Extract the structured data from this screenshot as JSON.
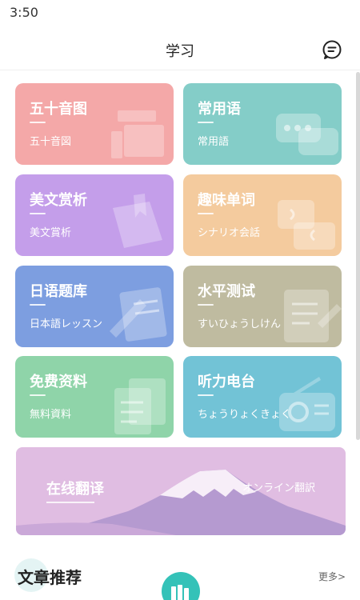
{
  "status_bar": {
    "time": "3:50"
  },
  "header": {
    "title": "学习",
    "message_icon": "chat-bubble-icon"
  },
  "cards": [
    {
      "title": "五十音图",
      "subtitle": "五十音図",
      "color": "#f4a8a8",
      "icon": "book-stack-icon"
    },
    {
      "title": "常用语",
      "subtitle": "常用語",
      "color": "#84cdc8",
      "icon": "chat-bubbles-icon"
    },
    {
      "title": "美文赏析",
      "subtitle": "美文賞析",
      "color": "#c49eea",
      "icon": "bookmark-book-icon"
    },
    {
      "title": "趣味单词",
      "subtitle": "シナリオ会話",
      "color": "#f4cb9e",
      "icon": "speech-dialog-icon"
    },
    {
      "title": "日语题库",
      "subtitle": "日本語レッスン",
      "color": "#7d9ee0",
      "icon": "document-pen-icon"
    },
    {
      "title": "水平测试",
      "subtitle": "すいひょうしけん",
      "color": "#bfbba0",
      "icon": "test-paper-icon"
    },
    {
      "title": "免费资料",
      "subtitle": "無料資料",
      "color": "#8fd4a9",
      "icon": "documents-icon"
    },
    {
      "title": "听力电台",
      "subtitle": "ちょうりょくきょく",
      "color": "#72c3d6",
      "icon": "radio-icon"
    }
  ],
  "banner": {
    "title": "在线翻译",
    "subtitle": "オンライン翻訳",
    "color": "#e0bde2",
    "icon": "mount-fuji-icon"
  },
  "articles": {
    "title": "文章推荐",
    "more": "更多>"
  },
  "fab": {
    "icon": "books-icon"
  }
}
